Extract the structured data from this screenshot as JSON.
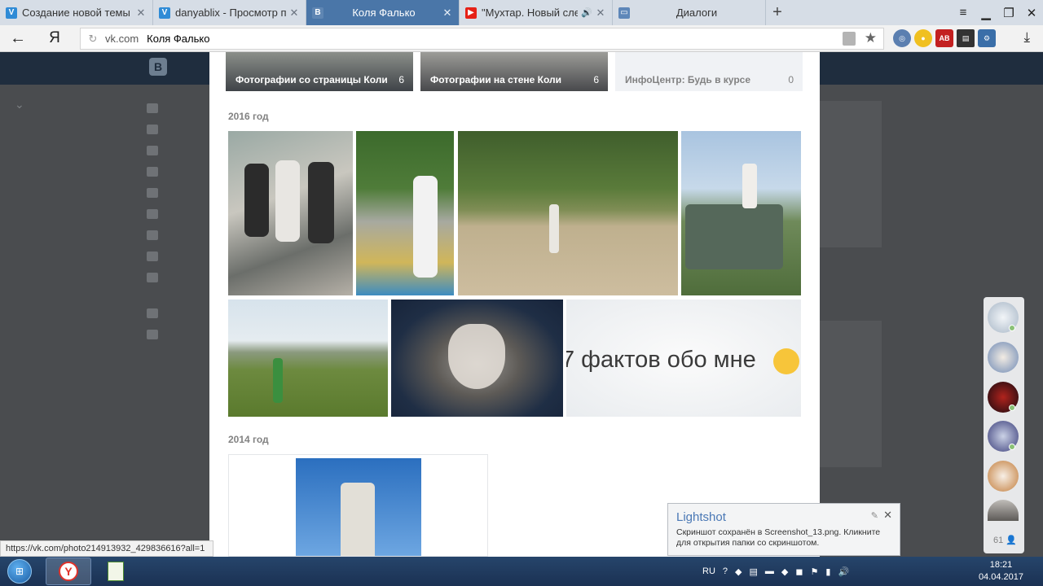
{
  "browser": {
    "tabs": [
      {
        "title": "Создание новой темы - Vin",
        "favicon": "vine-icon",
        "active": false
      },
      {
        "title": "danyablix - Просмотр проф",
        "favicon": "vine-icon",
        "active": false
      },
      {
        "title": "Коля Фалько",
        "favicon": "vk-icon",
        "active": true
      },
      {
        "title": "\"Мухтар. Новый след",
        "favicon": "youtube-icon",
        "active": false
      },
      {
        "title": "Диалоги",
        "favicon": "dialog-icon",
        "active": false
      }
    ],
    "new_tab": "+",
    "address": {
      "domain": "vk.com",
      "title": "Коля Фалько"
    },
    "status_url": "https://vk.com/photo214913932_429836616?all=1"
  },
  "albums": [
    {
      "name": "Фотографии со страницы Коли",
      "count": "6"
    },
    {
      "name": "Фотографии на стене Коли",
      "count": "6"
    },
    {
      "name": "ИнфоЦентр: Будь в курсе",
      "count": "0"
    }
  ],
  "years": [
    {
      "label": "2016 год"
    },
    {
      "label": "2014 год"
    }
  ],
  "photo_text": "7 фактов обо мне",
  "chat": {
    "count": "61"
  },
  "lightshot": {
    "title": "Lightshot",
    "body": "Скриншот сохранён в Screenshot_13.png. Кликните для открытия папки со скриншотом."
  },
  "taskbar": {
    "lang": "RU",
    "time": "18:21",
    "date": "04.04.2017"
  },
  "colors": {
    "vk_blue": "#4a76a8",
    "tab_bg": "#d6dde6",
    "overlay": "#4a4c4f"
  }
}
